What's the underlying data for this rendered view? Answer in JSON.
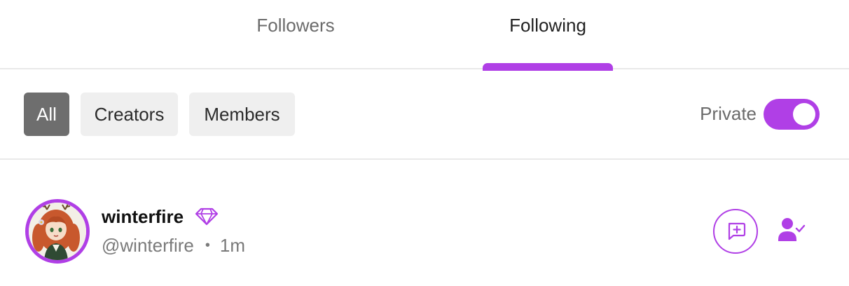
{
  "tabs": [
    {
      "label": "Followers",
      "active": false
    },
    {
      "label": "Following",
      "active": true
    }
  ],
  "filters": {
    "chips": [
      {
        "label": "All",
        "active": true
      },
      {
        "label": "Creators",
        "active": false
      },
      {
        "label": "Members",
        "active": false
      }
    ],
    "private_label": "Private",
    "private_enabled": true
  },
  "users": [
    {
      "display_name": "winterfire",
      "handle": "@winterfire",
      "separator": "•",
      "time": "1m",
      "badge_icon": "diamond-icon",
      "actions": [
        "message-plus-icon",
        "user-check-icon"
      ]
    }
  ],
  "colors": {
    "accent": "#b03fe6",
    "chip_active": "#6e6e6e",
    "chip_inactive": "#efefef",
    "muted_text": "#6b6b6b",
    "divider": "#e9e9e9"
  }
}
